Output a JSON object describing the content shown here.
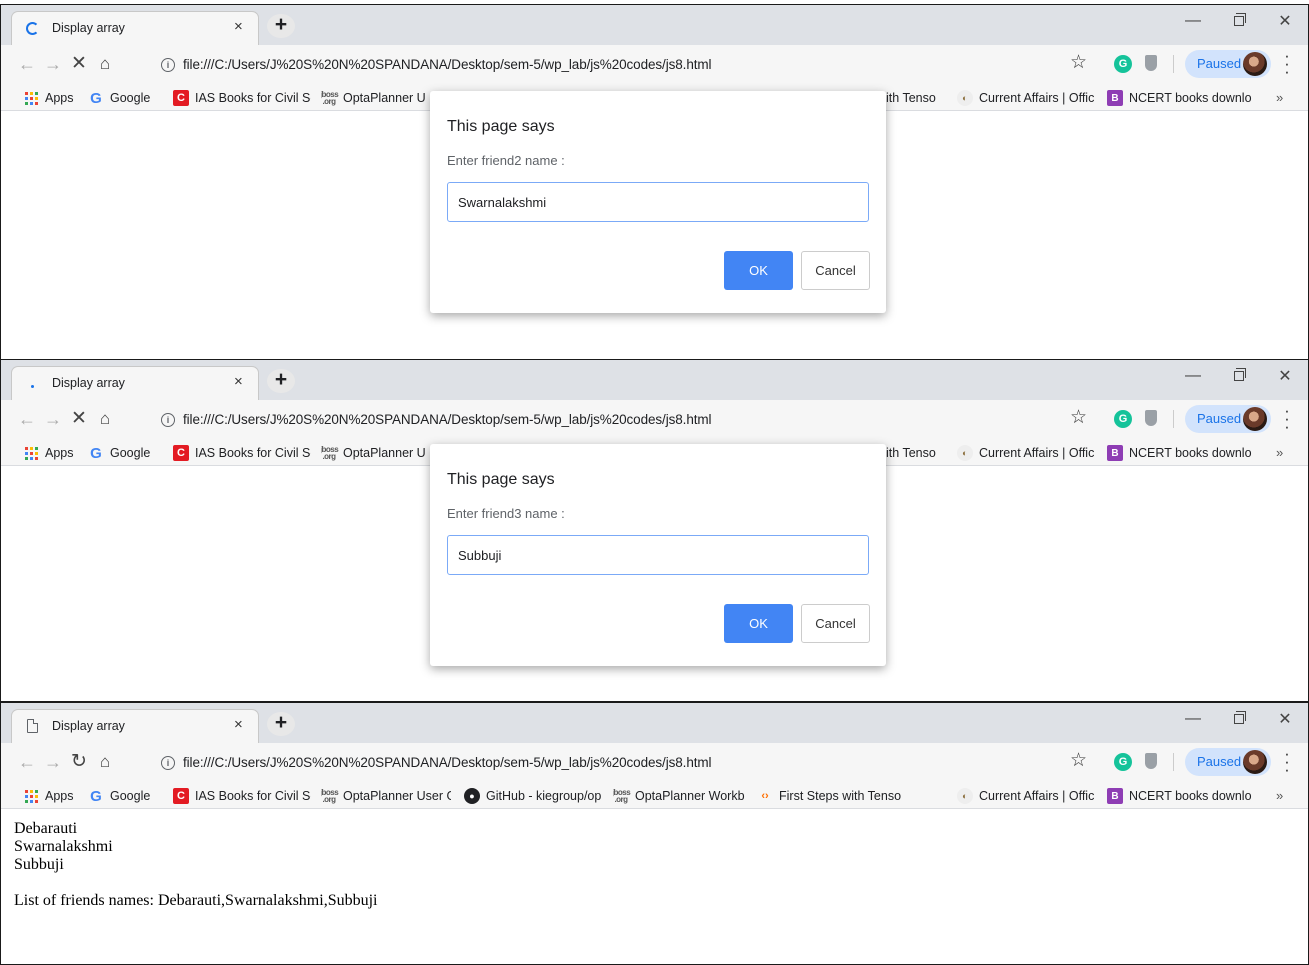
{
  "colors": {
    "accent": "#4285f4",
    "spinner": "#1a73e8"
  },
  "windows": [
    {
      "tab": {
        "title": "Display array",
        "favicon": "loading-spinner-icon",
        "close": "×"
      },
      "toolbar": {
        "url": "file:///C:/Users/J%20S%20N%20SPANDANA/Desktop/sem-5/wp_lab/js%20codes/js8.html",
        "reload_state": "stop"
      },
      "dialog": {
        "title": "This page says",
        "message": "Enter friend2 name :",
        "value": "Swarnalakshmi",
        "ok_label": "OK",
        "cancel_label": "Cancel"
      }
    },
    {
      "tab": {
        "title": "Display array",
        "favicon": "loading-dot-icon",
        "close": "×"
      },
      "toolbar": {
        "url": "file:///C:/Users/J%20S%20N%20SPANDANA/Desktop/sem-5/wp_lab/js%20codes/js8.html",
        "reload_state": "stop"
      },
      "dialog": {
        "title": "This page says",
        "message": "Enter friend3 name :",
        "value": "Subbuji",
        "ok_label": "OK",
        "cancel_label": "Cancel"
      }
    },
    {
      "tab": {
        "title": "Display array",
        "favicon": "page-icon",
        "close": "×"
      },
      "toolbar": {
        "url": "file:///C:/Users/J%20S%20N%20SPANDANA/Desktop/sem-5/wp_lab/js%20codes/js8.html",
        "reload_state": "reload"
      },
      "content": {
        "lines": [
          "Debarauti",
          "Swarnalakshmi",
          "Subbuji"
        ],
        "summary": "List of friends names: Debarauti,Swarnalakshmi,Subbuji"
      }
    }
  ],
  "profile": {
    "label": "Paused"
  },
  "extensions": {
    "grammarly": "G"
  },
  "bookmarks_dialog": {
    "apps": "Apps",
    "google": "Google",
    "ias": "IAS Books for Civil Se",
    "optaplanner": "OptaPlanner U",
    "tensorflow": "ith Tenso",
    "current_affairs": "Current Affairs | Offic",
    "ncert": "NCERT books downlo",
    "more": "»"
  },
  "bookmarks_full": {
    "apps": "Apps",
    "google": "Google",
    "ias": "IAS Books for Civil Se",
    "optaplanner": "OptaPlanner User Gu",
    "github": "GitHub - kiegroup/op",
    "optaplanner_workbench": "OptaPlanner Workbe",
    "tensorflow": "First Steps with Tenso",
    "current_affairs": "Current Affairs | Offic",
    "ncert": "NCERT books downlo",
    "more": "»"
  }
}
